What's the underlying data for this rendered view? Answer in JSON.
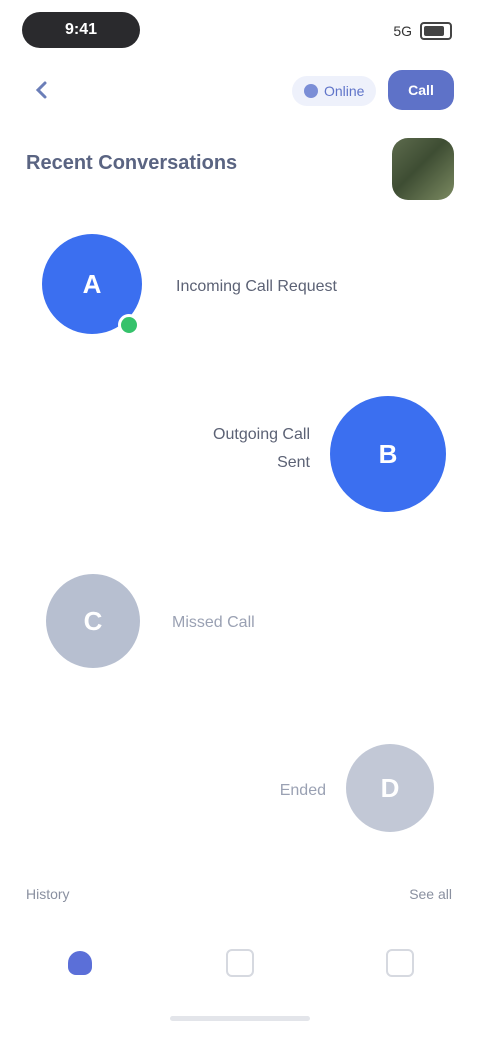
{
  "status_bar": {
    "time": "9:41",
    "signal": "5G"
  },
  "top_bar": {
    "secondary_chip_label": "Online",
    "primary_chip_label": "Call"
  },
  "header": {
    "title": "Recent Conversations"
  },
  "calls": [
    {
      "label": "Incoming Call Request",
      "label2": "",
      "avatar_initial": "A",
      "avatar_color": "#3b6ff0",
      "online": true
    },
    {
      "label": "Outgoing Call",
      "label2": "Sent",
      "avatar_initial": "B",
      "avatar_color": "#3b6ff0",
      "online": false
    },
    {
      "label": "Missed Call",
      "label2": "",
      "avatar_initial": "C",
      "avatar_color": "#b7bfd0",
      "online": false
    },
    {
      "label": "Ended",
      "label2": "",
      "avatar_initial": "D",
      "avatar_color": "#c2c8d6",
      "online": false
    }
  ],
  "footer": {
    "left_caption": "History",
    "right_caption": "See all"
  },
  "nav": [
    {
      "name": "home",
      "active": true
    },
    {
      "name": "calls",
      "active": false
    },
    {
      "name": "profile",
      "active": false
    }
  ],
  "colors": {
    "accent": "#3b6ff0",
    "accent_soft": "#5e72c8",
    "muted_avatar": "#b7bfd0",
    "online": "#35c26b"
  }
}
